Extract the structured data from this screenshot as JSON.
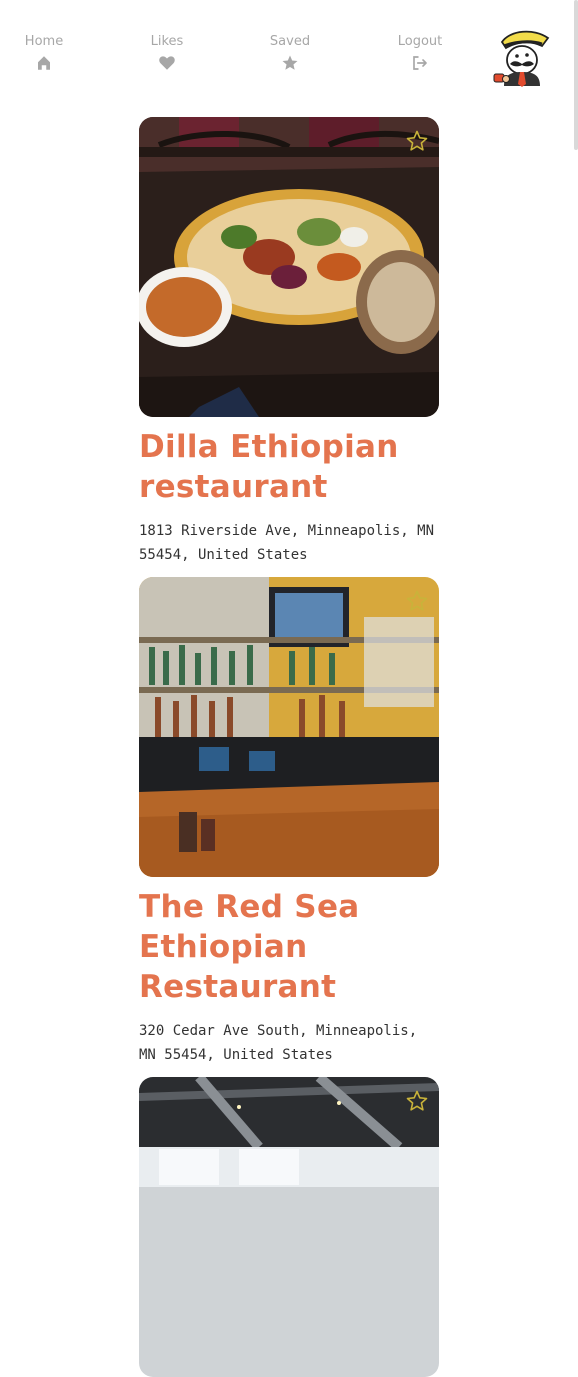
{
  "nav": {
    "items": [
      {
        "label": "Home",
        "icon": "home-icon"
      },
      {
        "label": "Likes",
        "icon": "heart-icon"
      },
      {
        "label": "Saved",
        "icon": "star-icon"
      },
      {
        "label": "Logout",
        "icon": "logout-icon"
      }
    ],
    "avatar_icon": "mustache-chef-mascot-icon"
  },
  "colors": {
    "accent": "#e4744e",
    "nav_text": "#a7a7a7",
    "star_outline": "#c9b33a",
    "background": "#ffffff"
  },
  "restaurants": [
    {
      "name": "Dilla Ethiopian restaurant",
      "address": "1813 Riverside Ave, Minneapolis, MN 55454, United States",
      "photo_icon": "injera-platter-photo",
      "saved": false
    },
    {
      "name": "The Red Sea Ethiopian Restaurant",
      "address": "320 Cedar Ave South, Minneapolis, MN 55454, United States",
      "photo_icon": "bar-interior-photo",
      "saved": false
    },
    {
      "photo_icon": "restaurant-interior-photo",
      "saved": false
    }
  ]
}
